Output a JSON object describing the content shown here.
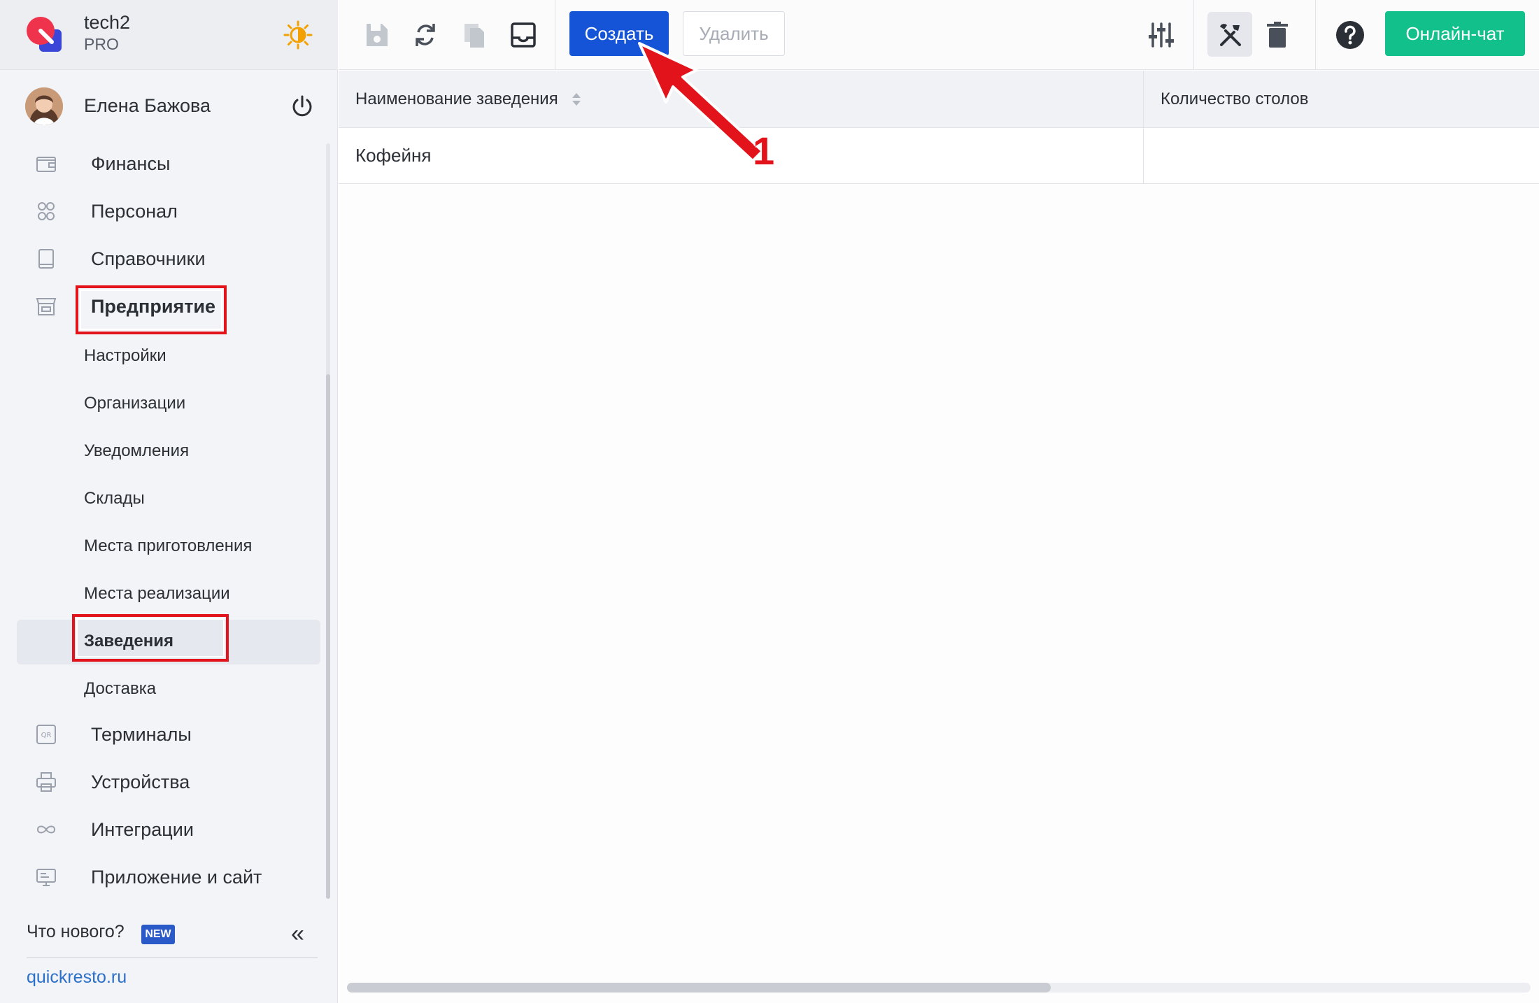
{
  "app": {
    "name": "tech2",
    "plan": "PRO"
  },
  "user": {
    "name": "Елена Бажова"
  },
  "sidebar": {
    "items": [
      {
        "label": "Финансы",
        "icon": "wallet-icon"
      },
      {
        "label": "Персонал",
        "icon": "people-icon"
      },
      {
        "label": "Справочники",
        "icon": "book-icon"
      },
      {
        "label": "Предприятие",
        "icon": "store-icon"
      }
    ],
    "subitems": [
      {
        "label": "Настройки"
      },
      {
        "label": "Организации"
      },
      {
        "label": "Уведомления"
      },
      {
        "label": "Склады"
      },
      {
        "label": "Места приготовления"
      },
      {
        "label": "Места реализации"
      },
      {
        "label": "Заведения"
      },
      {
        "label": "Доставка"
      }
    ],
    "items_after": [
      {
        "label": "Терминалы",
        "icon": "qr-icon"
      },
      {
        "label": "Устройства",
        "icon": "printer-icon"
      },
      {
        "label": "Интеграции",
        "icon": "infinity-icon"
      },
      {
        "label": "Приложение и сайт",
        "icon": "monitor-icon"
      }
    ],
    "whats_new": "Что нового?",
    "new_badge": "NEW",
    "site": "quickresto.ru"
  },
  "toolbar": {
    "create": "Создать",
    "delete": "Удалить",
    "chat": "Онлайн-чат"
  },
  "table": {
    "columns": [
      "Наименование заведения",
      "Количество столов"
    ],
    "rows": [
      [
        "Кофейня",
        ""
      ]
    ]
  },
  "annotation": {
    "number": "1"
  },
  "colors": {
    "accent": "#1554d6",
    "chat": "#12c08b",
    "highlight": "#e3131b"
  }
}
